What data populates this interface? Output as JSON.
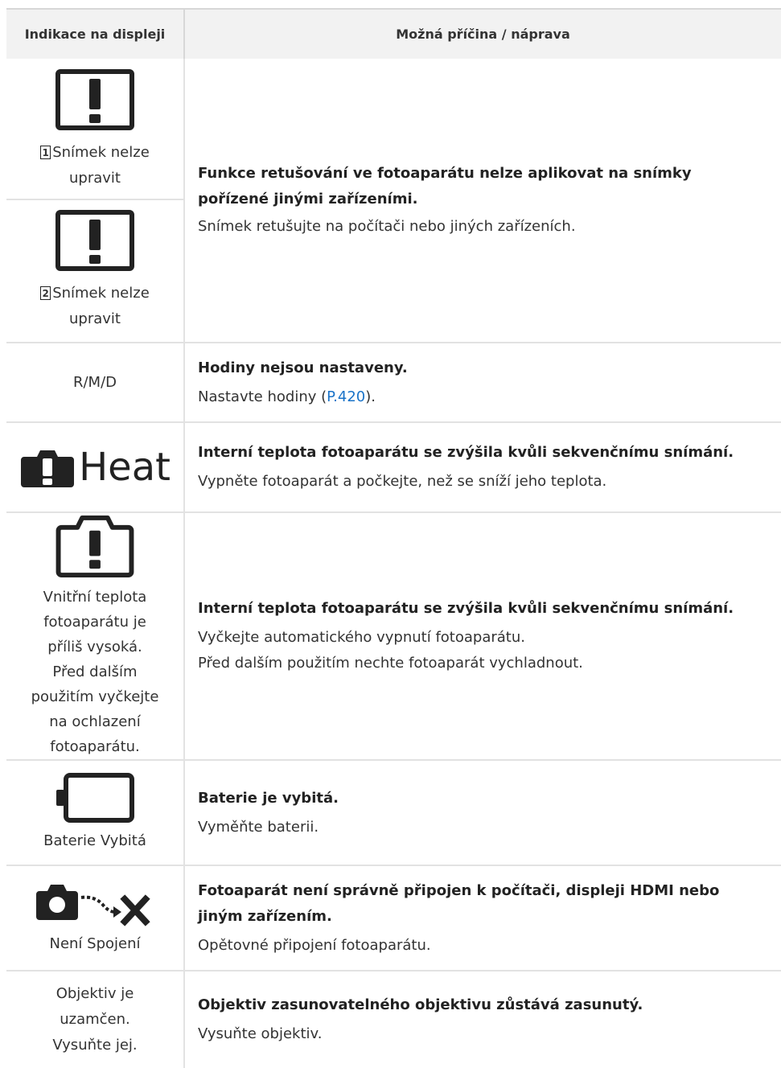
{
  "header": {
    "col1": "Indikace na displeji",
    "col2": "Možná příčina / náprava"
  },
  "rows": [
    {
      "left1_num": "1",
      "left1_text": "Snímek nelze upravit",
      "left2_num": "2",
      "left2_text": "Snímek nelze upravit",
      "icon": "exclamation-box-icon",
      "cause": "Funkce retušování ve fotoaparátu nelze aplikovat na snímky pořízené jinými zařízeními.",
      "remedy": "Snímek retušujte na počítači nebo jiných zařízeních."
    },
    {
      "left_text": "R/M/D",
      "cause": "Hodiny nejsou nastaveny.",
      "remedy_pre": "Nastavte hodiny (",
      "remedy_link": "P.420",
      "remedy_post": ")."
    },
    {
      "icon": "heat-warning-icon",
      "icon_text": "Heat",
      "cause": "Interní teplota fotoaparátu se zvýšila kvůli sekvenčnímu snímání.",
      "remedy": "Vypněte fotoaparát a počkejte, než se sníží jeho teplota."
    },
    {
      "icon": "camera-warning-icon",
      "left_text": "Vnitřní teplota fotoaparátu je příliš vysoká. Před dalším použitím vyčkejte na ochlazení fotoaparátu.",
      "cause": "Interní teplota fotoaparátu se zvýšila kvůli sekvenčnímu snímání.",
      "remedy1": "Vyčkejte automatického vypnutí fotoaparátu.",
      "remedy2": "Před dalším použitím nechte fotoaparát vychladnout."
    },
    {
      "icon": "battery-empty-icon",
      "left_text": "Baterie Vybitá",
      "cause": "Baterie je vybitá.",
      "remedy": "Vyměňte baterii."
    },
    {
      "icon": "no-connection-icon",
      "left_text": "Není Spojení",
      "cause": "Fotoaparát není správně připojen k počítači, displeji HDMI nebo jiným zařízením.",
      "remedy": "Opětovné připojení fotoaparátu."
    },
    {
      "left_text": "Objektiv je uzamčen. Vysuňte jej.",
      "cause": "Objektiv zasunovatelného objektivu zůstává zasunutý.",
      "remedy": "Vysuňte objektiv."
    }
  ]
}
